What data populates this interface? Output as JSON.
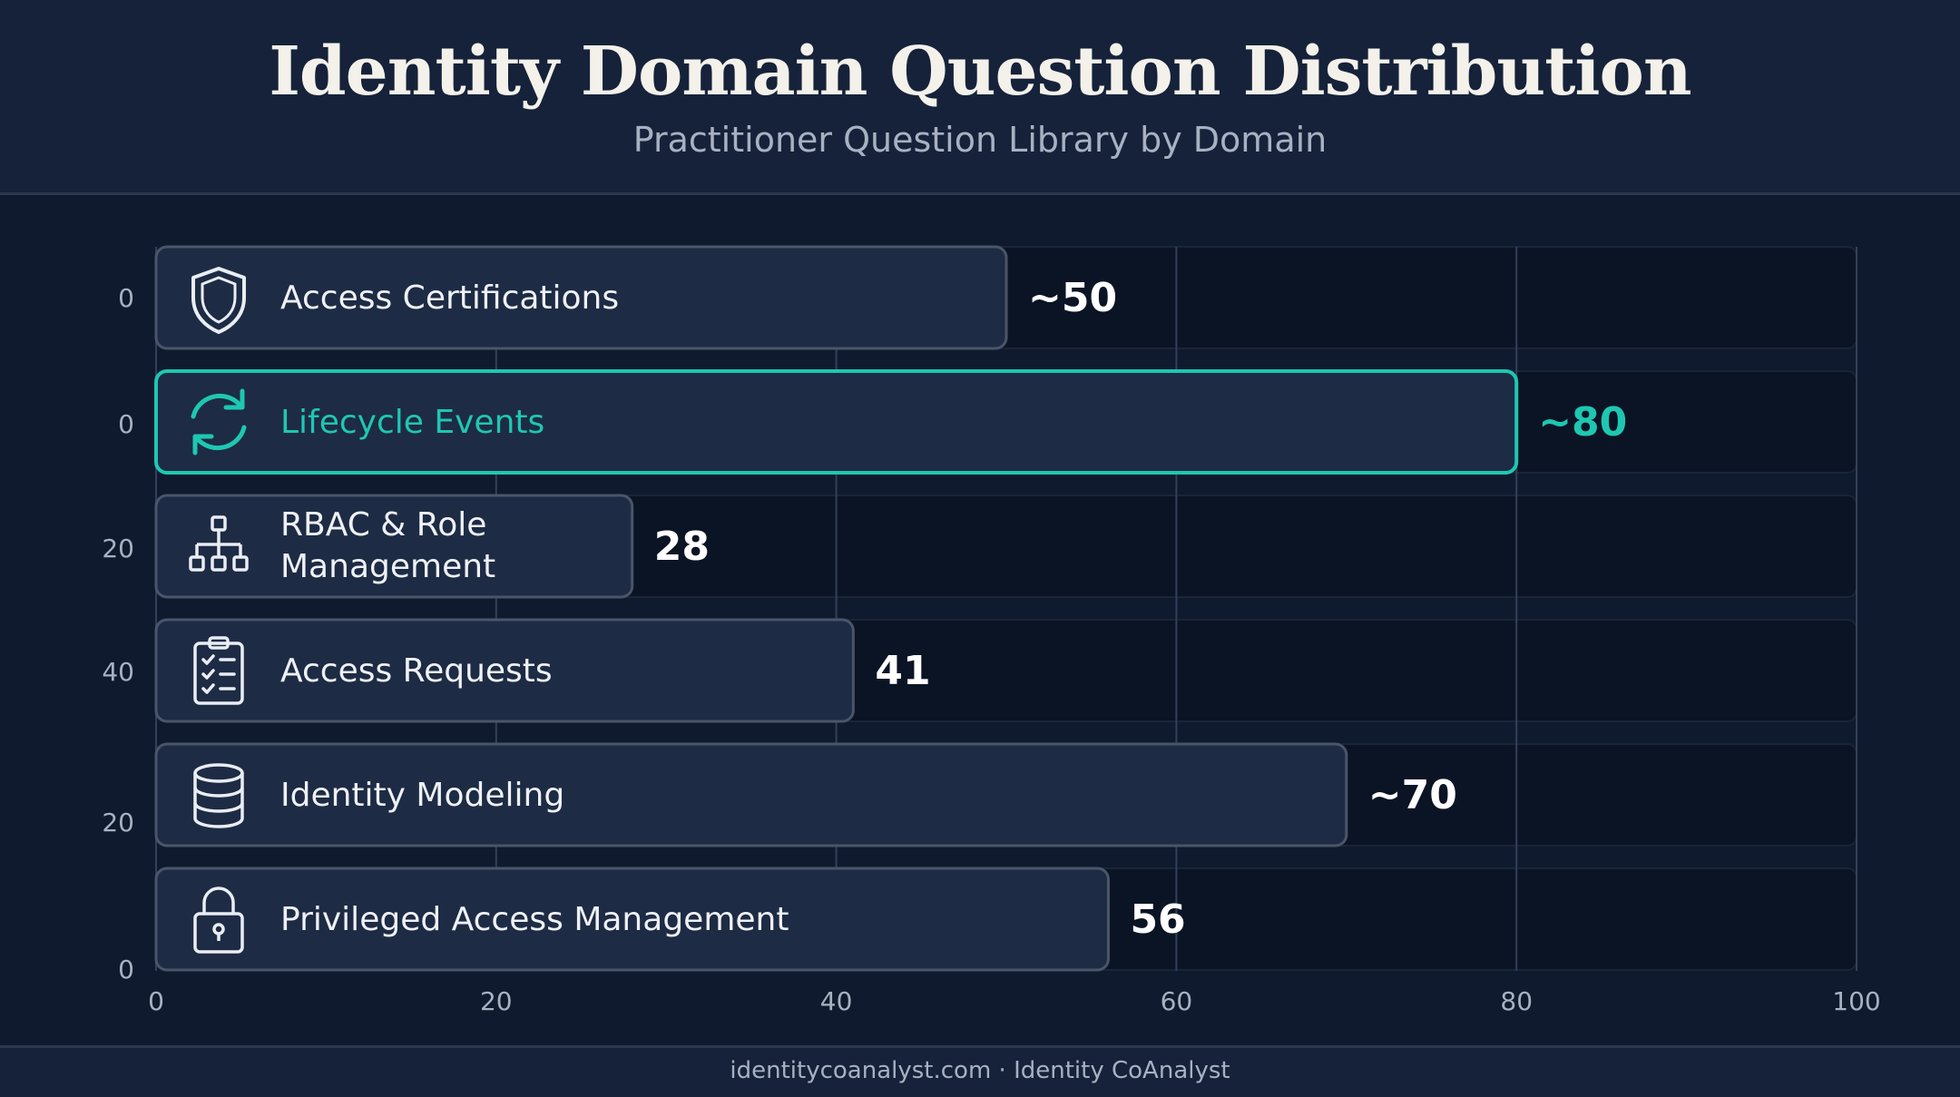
{
  "header": {
    "title": "Identity Domain Question Distribution",
    "subtitle": "Practitioner Question Library by Domain"
  },
  "footer": {
    "text": "identitycoanalyst.com · Identity CoAnalyst"
  },
  "colors": {
    "accent": "#1ec7b1",
    "bar_fill": "#1e2b44",
    "bar_border": "#4a5568",
    "track": "#0b1425",
    "text": "#eef1f6",
    "muted": "#a7b1c2"
  },
  "chart_data": {
    "type": "bar",
    "orientation": "horizontal",
    "grid": true,
    "xlim": [
      0,
      100
    ],
    "x_ticks": [
      "0",
      "20",
      "40",
      "60",
      "80",
      "100"
    ],
    "y_ticks": [
      "0",
      "0",
      "20",
      "40",
      "20",
      "0"
    ],
    "categories": [
      "Access Certifications",
      "Lifecycle Events",
      "RBAC & Role Management",
      "Access Requests",
      "Identity Modeling",
      "Privileged Access Management"
    ],
    "label_lines": [
      [
        "Access Certifications"
      ],
      [
        "Lifecycle Events"
      ],
      [
        "RBAC & Role",
        "Management"
      ],
      [
        "Access Requests"
      ],
      [
        "Identity Modeling"
      ],
      [
        "Privileged Access Management"
      ]
    ],
    "values": [
      50,
      80,
      28,
      41,
      70,
      56
    ],
    "value_labels": [
      "~50",
      "~80",
      "28",
      "41",
      "~70",
      "56"
    ],
    "icons": [
      "shield-icon",
      "refresh-icon",
      "org-chart-icon",
      "clipboard-checklist-icon",
      "database-icon",
      "lock-icon"
    ],
    "highlighted": "Lifecycle Events"
  }
}
